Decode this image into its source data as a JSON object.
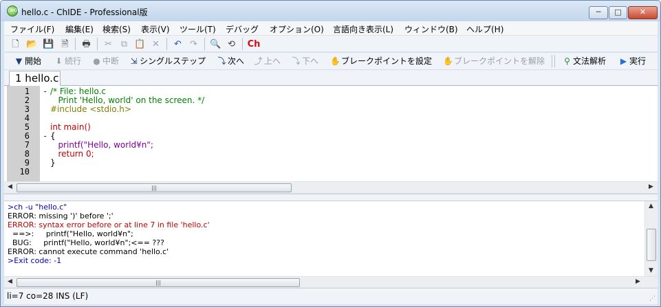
{
  "window": {
    "title": "hello.c - ChIDE - Professional版",
    "app_icon_text": "ChIDE",
    "controls": {
      "minimize": "─",
      "maximize": "□",
      "close": "✕"
    }
  },
  "menu": [
    "ファイル(F)",
    "編集(E)",
    "検索(S)",
    "表示(V)",
    "ツール(T)",
    "デバッグ",
    "オプション(O)",
    "言語向き表示(L)",
    "ウィンドウ(B)",
    "ヘルプ(H)"
  ],
  "toolbar": {
    "ch_label": "Ch"
  },
  "debug_toolbar": {
    "start": "開始",
    "continue": "続行",
    "pause": "中断",
    "single_step": "シングルステップ",
    "next": "次へ",
    "up": "上へ",
    "down": "下へ",
    "set_breakpoint": "ブレークポイントを設定",
    "clear_breakpoint": "ブレークポイントを解除",
    "parse": "文法解析",
    "run": "実行"
  },
  "tab": {
    "label": "1 hello.c"
  },
  "editor": {
    "line_numbers": [
      "1",
      "2",
      "3",
      "4",
      "5",
      "6",
      "7",
      "8",
      "9",
      "10"
    ],
    "fold_markers": [
      "-",
      "",
      "",
      "",
      "",
      "-",
      "",
      "",
      "",
      ""
    ],
    "lines": [
      "/* File: hello.c",
      "   Print 'Hello, world' on the screen. */",
      "#include <stdio.h>",
      "",
      "int main()",
      "{",
      "   printf(\"Hello, world¥n\";",
      "   return 0;",
      "}",
      ""
    ]
  },
  "output": {
    "lines": [
      {
        "text": ">ch -u \"hello.c\"",
        "color": "#0000c0"
      },
      {
        "text": "ERROR: missing ')' before ';'",
        "color": "#000000"
      },
      {
        "text": "ERROR: syntax error before or at line 7 in file 'hello.c'",
        "color": "#c00000"
      },
      {
        "text": "  ==>:     printf(\"Hello, world¥n\";",
        "color": "#000000"
      },
      {
        "text": "  BUG:     printf(\"Hello, world¥n\";<== ???",
        "color": "#000000"
      },
      {
        "text": "ERROR: cannot execute command 'hello.c'",
        "color": "#000000"
      },
      {
        "text": ">Exit code: -1",
        "color": "#0000c0"
      }
    ]
  },
  "status": {
    "text": "li=7 co=28 INS (LF)"
  }
}
